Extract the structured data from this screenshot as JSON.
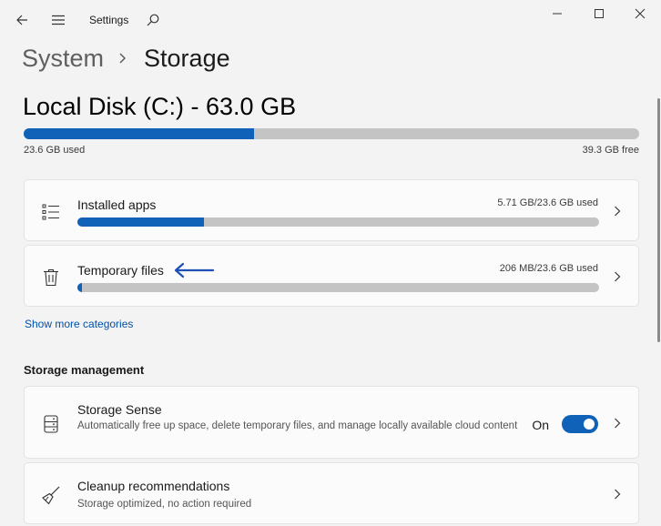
{
  "app": {
    "title": "Settings"
  },
  "breadcrumb": {
    "parent": "System",
    "current": "Storage"
  },
  "disk": {
    "title": "Local Disk (C:) - 63.0 GB",
    "used_label": "23.6 GB used",
    "free_label": "39.3 GB free",
    "used_fraction": 0.3746
  },
  "categories": [
    {
      "label": "Installed apps",
      "meta": "5.71 GB/23.6 GB used",
      "fraction": 0.242,
      "icon": "list-icon"
    },
    {
      "label": "Temporary files",
      "meta": "206 MB/23.6 GB used",
      "fraction": 0.0087,
      "icon": "trash-icon"
    }
  ],
  "show_more": "Show more categories",
  "management": {
    "title": "Storage management",
    "storage_sense": {
      "label": "Storage Sense",
      "description": "Automatically free up space, delete temporary files, and manage locally available cloud content",
      "toggle_label": "On",
      "toggle_on": true,
      "icon": "drive-icon"
    },
    "cleanup": {
      "label": "Cleanup recommendations",
      "description": "Storage optimized, no action required",
      "icon": "broom-icon"
    }
  },
  "colors": {
    "accent": "#0f62b8",
    "track": "#c4c4c4",
    "annotation_arrow": "#1d4fb5"
  }
}
